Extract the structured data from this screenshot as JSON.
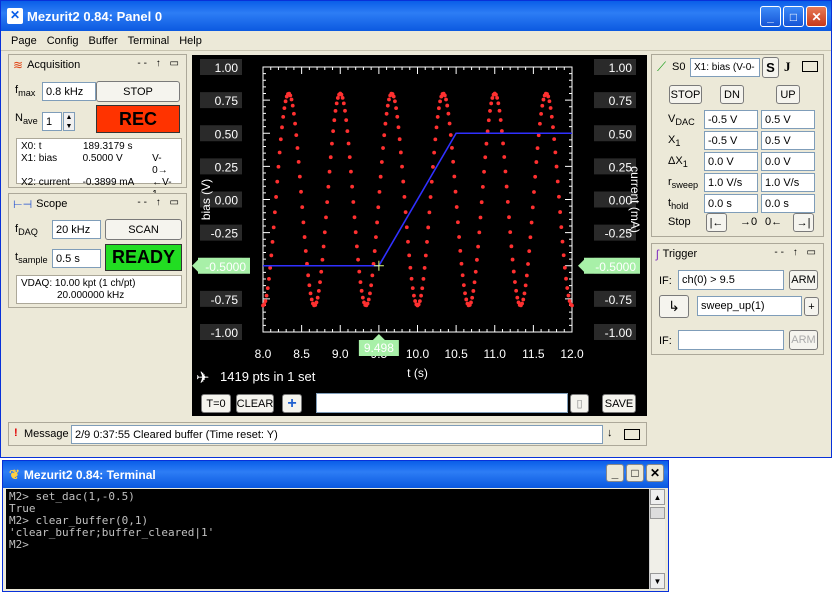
{
  "main_window": {
    "title": "Mezurit2 0.84: Panel 0"
  },
  "menu": [
    "Page",
    "Config",
    "Buffer",
    "Terminal",
    "Help"
  ],
  "acquisition": {
    "title": "Acquisition",
    "fmax_label": "f",
    "fmax_sub": "max",
    "fmax_value": "0.8 kHz",
    "stop_label": "STOP",
    "nave_label": "N",
    "nave_sub": "ave",
    "nave_value": "1",
    "rec_label": "REC",
    "info": [
      {
        "name": "X0: t",
        "value": "189.3179 s",
        "extra": ""
      },
      {
        "name": "X1: bias",
        "value": "0.5000 V",
        "extra": "V-0→"
      },
      {
        "name": "X2: current",
        "value": "-0.3899 mA",
        "extra": "←V-1"
      }
    ]
  },
  "scope": {
    "title": "Scope",
    "fdaq_label": "f",
    "fdaq_sub": "DAQ",
    "fdaq_value": "20 kHz",
    "scan_label": "SCAN",
    "tsample_label": "t",
    "tsample_sub": "sample",
    "tsample_value": "0.5 s",
    "ready_label": "READY",
    "info_line1": "VDAQ: 10.00 kpt (1 ch/pt)",
    "info_line2": "20.000000 kHz"
  },
  "plot": {
    "left_ticks": [
      "1.00",
      "0.75",
      "0.50",
      "0.25",
      "0.00",
      "-0.25",
      "-0.50",
      "-0.75",
      "-1.00"
    ],
    "right_ticks": [
      "1.00",
      "0.75",
      "0.50",
      "0.25",
      "0.00",
      "-0.25",
      "-0.50",
      "-0.75",
      "-1.00"
    ],
    "x_ticks": [
      "8.0",
      "8.5",
      "9.0",
      "9.5",
      "10.0",
      "10.5",
      "11.0",
      "11.5",
      "12.0"
    ],
    "y_left_label": "bias (V)",
    "y_right_label": "current (mA)",
    "x_label": "t (s)",
    "left_marker": "-0.5000",
    "right_marker": "-0.5000",
    "x_marker": "9.498",
    "pts_text": "1419 pts in 1 set",
    "t0_label": "T=0",
    "clear_label": "CLEAR",
    "plus_label": "+",
    "save_label": "SAVE"
  },
  "chart_data": {
    "type": "line",
    "xlabel": "t (s)",
    "ylabel": "bias (V)",
    "y2label": "current (mA)",
    "xlim": [
      8.0,
      12.0
    ],
    "ylim": [
      -1.0,
      1.0
    ],
    "series": [
      {
        "color": "#ff3030",
        "style": "dots",
        "amplitude": 0.8,
        "period": 0.6667,
        "t_start": 8.0,
        "t_end": 12.0,
        "start_phase": "minimum"
      },
      {
        "color": "#3030ff",
        "style": "line",
        "x": [
          8.0,
          9.5,
          10.5,
          12.0
        ],
        "y": [
          -0.5,
          -0.5,
          0.5,
          0.5
        ]
      }
    ]
  },
  "sweep": {
    "s0_label": "S0",
    "channel_value": "X1: bias (V-0-",
    "s_btn": "S",
    "j_label": "J",
    "stop_label": "STOP",
    "dn_label": "DN",
    "up_label": "UP",
    "rows": [
      {
        "label": "V",
        "sub": "DAC",
        "a": "-0.5 V",
        "b": "0.5 V"
      },
      {
        "label": "X",
        "sub": "1",
        "a": "-0.5 V",
        "b": "0.5 V"
      },
      {
        "label": "ΔX",
        "sub": "1",
        "a": "0.0 V",
        "b": "0.0 V"
      },
      {
        "label": "r",
        "sub": "sweep",
        "a": "1.0 V/s",
        "b": "1.0 V/s"
      },
      {
        "label": "t",
        "sub": "hold",
        "a": "0.0 s",
        "b": "0.0 s"
      }
    ],
    "stop_row_label": "Stop",
    "stop_left": "|←",
    "to0": "→0",
    "from0": "0←",
    "stop_right": "→|"
  },
  "trigger": {
    "title": "Trigger",
    "if_label": "IF:",
    "if_value": "ch(0) > 9.5",
    "arm_label": "ARM",
    "action_value": "sweep_up(1)",
    "plus_label": "+",
    "if2_label": "IF:",
    "if2_value": "",
    "arm2_label": "ARM"
  },
  "message": {
    "label": "Message",
    "text": "2/9 0:37:55  Cleared buffer (Time reset: Y)"
  },
  "terminal": {
    "title": "Mezurit2 0.84: Terminal",
    "lines": [
      "M2> set_dac(1,-0.5)",
      "True",
      "M2> clear_buffer(0,1)",
      "'clear_buffer;buffer_cleared|1'",
      "M2>"
    ]
  },
  "colors": {
    "rec": "#ff3300",
    "ready": "#22dd22",
    "marker": "#a8f0a8",
    "accent_blue": "#0a5ee8"
  }
}
